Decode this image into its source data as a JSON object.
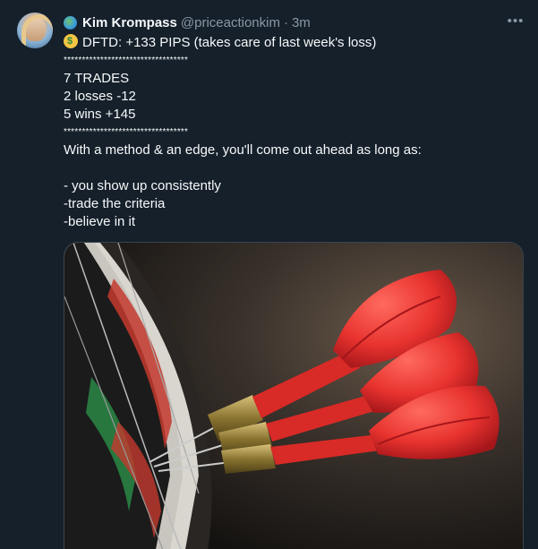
{
  "tweet": {
    "author_name": "Kim Krompass",
    "handle": "@priceactionkim",
    "separator": "·",
    "time": "3m",
    "more_glyph": "•••",
    "lines": [
      "DFTD: +133 PIPS (takes care of last week's loss)",
      "**********************************",
      "7 TRADES",
      "2 losses -12",
      "5 wins +145",
      "**********************************",
      "With a method & an edge, you'll come out ahead as long as:",
      "",
      "- you show up consistently",
      "-trade the criteria",
      "-believe in it"
    ],
    "icons": {
      "author_badge": "globe-icon",
      "money_emoji": "money-mouth-face-icon",
      "more": "more-icon"
    },
    "media_description_icon": "darts-image"
  },
  "colors": {
    "background": "#15202b",
    "text": "#f7f9f9",
    "secondary": "#8b98a5",
    "dart_red": "#e8332f"
  }
}
